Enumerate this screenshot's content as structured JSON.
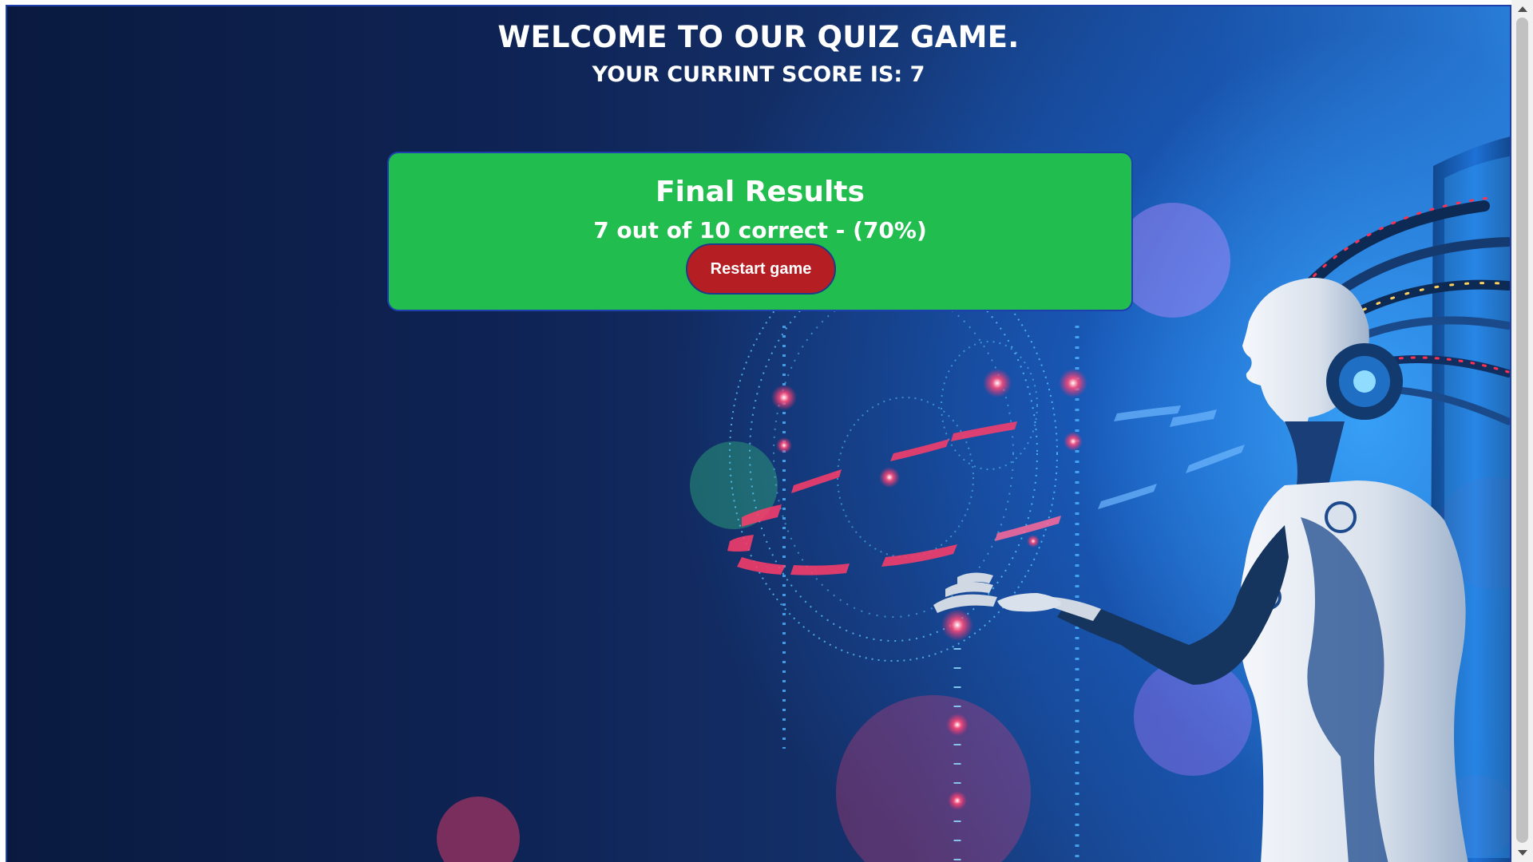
{
  "header": {
    "title": "WELCOME TO OUR QUIZ GAME.",
    "score_text": "YOUR CURRINT SCORE IS: 7"
  },
  "results": {
    "title": "Final Results",
    "summary": "7 out of 10 correct - (70%)",
    "restart_label": "Restart game"
  },
  "colors": {
    "card_green": "#21bd4f",
    "button_red": "#b51f24",
    "border_blue": "#1e40af",
    "background_navy": "#0f2456"
  },
  "background": {
    "image_subject": "robot-woman-ai-hologram-illustration"
  }
}
